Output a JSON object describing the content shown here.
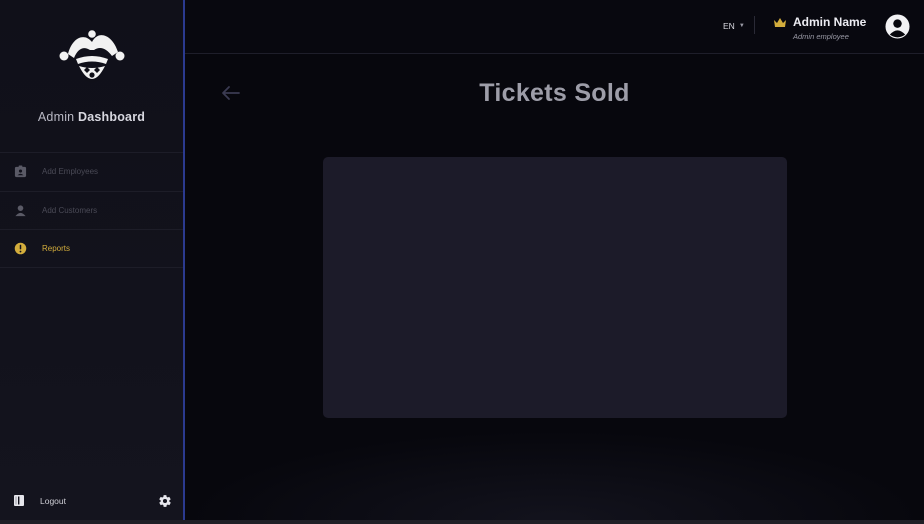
{
  "sidebar": {
    "brand_light": "Admin",
    "brand_bold": "Dashboard",
    "items": [
      {
        "label": "Add Employees",
        "icon": "id-badge-icon"
      },
      {
        "label": "Add Customers",
        "icon": "person-icon"
      },
      {
        "label": "Reports",
        "icon": "alert-circle-icon",
        "active": true
      }
    ],
    "logout_label": "Logout",
    "active_color": "#d3ad3c",
    "accent_border": "#2b3a8f"
  },
  "header": {
    "language": "EN",
    "user_name": "Admin Name",
    "user_role": "Admin employee"
  },
  "main": {
    "title": "Tickets Sold"
  }
}
